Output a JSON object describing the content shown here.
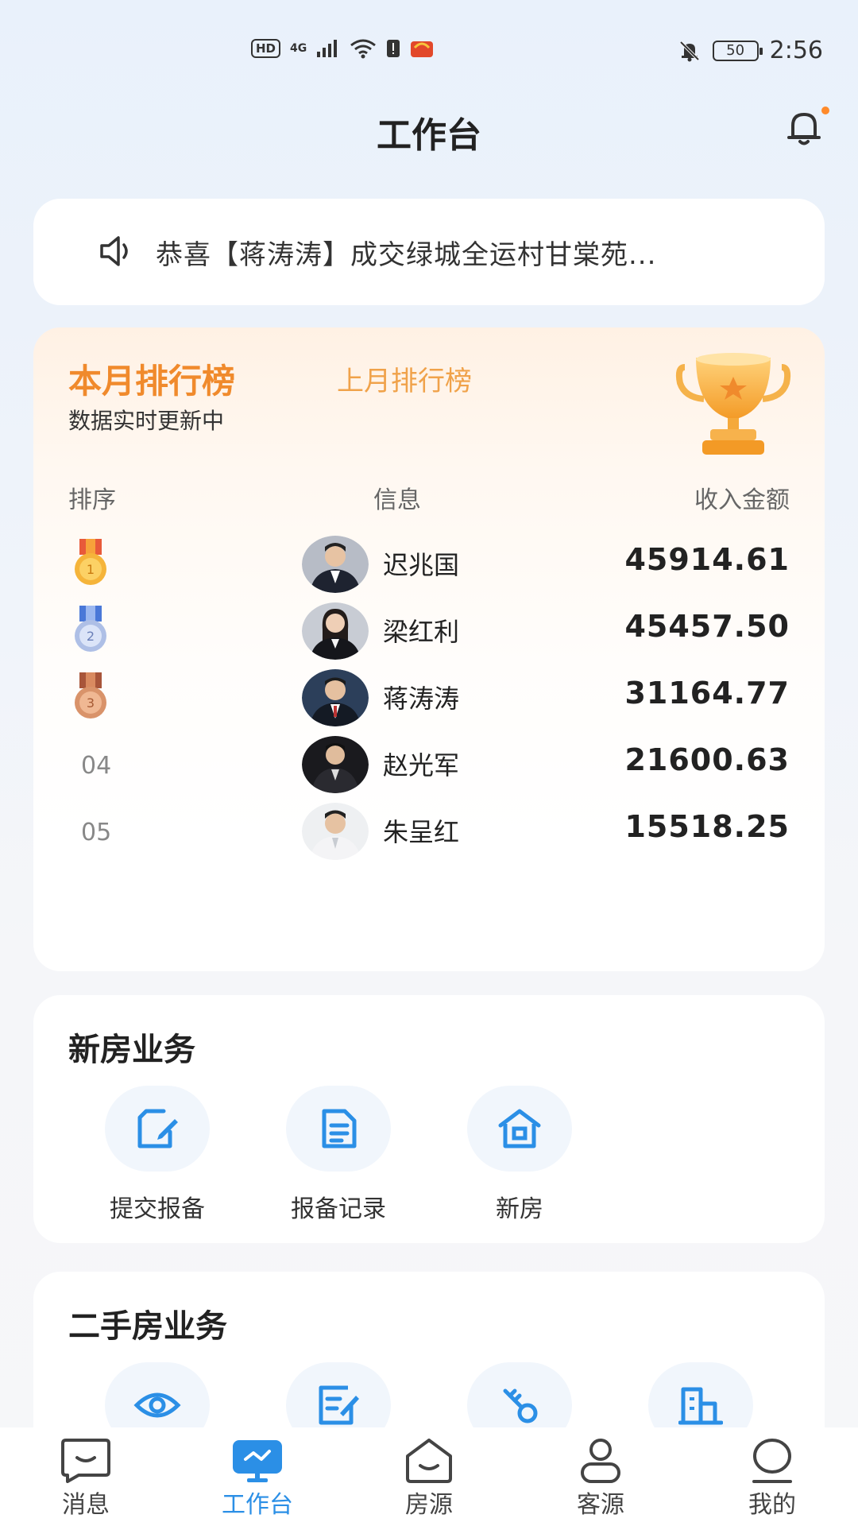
{
  "status_bar": {
    "time": "2:56",
    "battery": "50",
    "hd": "HD",
    "signal": "4G"
  },
  "header": {
    "title": "工作台"
  },
  "notice": {
    "text": "恭喜【蒋涛涛】成交绿城全运村甘棠苑..."
  },
  "ranking": {
    "tab_current": "本月排行榜",
    "tab_last": "上月排行榜",
    "subtitle": "数据实时更新中",
    "columns": {
      "rank": "排序",
      "info": "信息",
      "amount": "收入金额"
    },
    "rows": [
      {
        "rank": "1",
        "name": "迟兆国",
        "amount": "45914.61",
        "medal": "gold"
      },
      {
        "rank": "2",
        "name": "梁红利",
        "amount": "45457.50",
        "medal": "silver"
      },
      {
        "rank": "3",
        "name": "蒋涛涛",
        "amount": "31164.77",
        "medal": "bronze"
      },
      {
        "rank": "04",
        "name": "赵光军",
        "amount": "21600.63"
      },
      {
        "rank": "05",
        "name": "朱呈红",
        "amount": "15518.25"
      }
    ]
  },
  "new_house": {
    "title": "新房业务",
    "items": [
      {
        "label": "提交报备",
        "icon": "edit-box-icon"
      },
      {
        "label": "报备记录",
        "icon": "document-icon"
      },
      {
        "label": "新房",
        "icon": "house-icon"
      }
    ]
  },
  "second_hand": {
    "title": "二手房业务",
    "items": [
      {
        "icon": "eye-icon"
      },
      {
        "icon": "edit-list-icon"
      },
      {
        "icon": "key-icon"
      },
      {
        "icon": "building-icon"
      }
    ]
  },
  "tabbar": {
    "items": [
      {
        "label": "消息",
        "icon": "message-icon"
      },
      {
        "label": "工作台",
        "icon": "workbench-icon"
      },
      {
        "label": "房源",
        "icon": "house-source-icon"
      },
      {
        "label": "客源",
        "icon": "customer-icon"
      },
      {
        "label": "我的",
        "icon": "profile-icon"
      }
    ]
  },
  "colors": {
    "accent_blue": "#2b8fe6",
    "rank_orange": "#f08a2c"
  }
}
